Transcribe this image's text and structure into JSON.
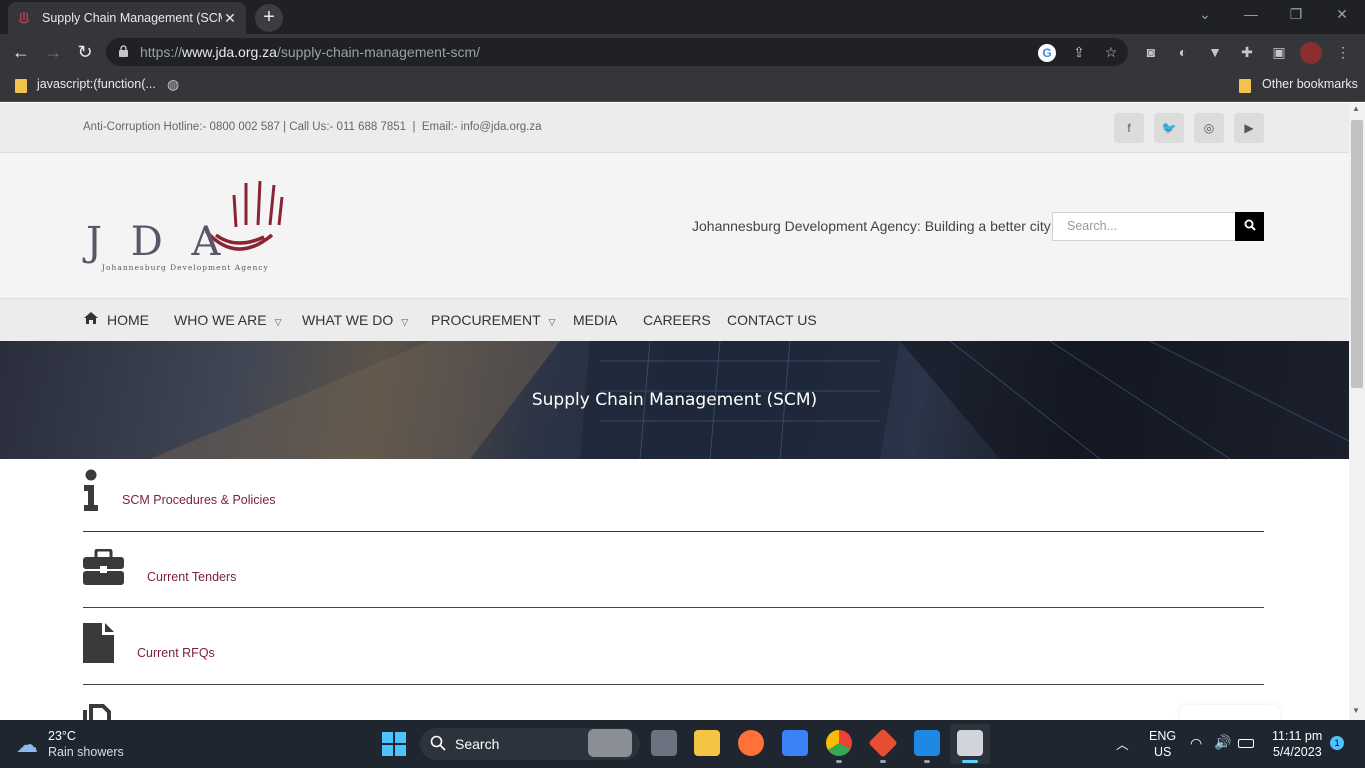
{
  "browser": {
    "tab_title": "Supply Chain Management (SCM)",
    "tab_close": "✕",
    "new_tab": "+",
    "url_scheme": "https://",
    "url_domain": "www.jda.org.za",
    "url_path": "/supply-chain-management-scm/",
    "bookmarks": [
      {
        "label": "javascript:(function(..."
      },
      {
        "label": "Other bookmarks"
      }
    ]
  },
  "site": {
    "contact_bar": "Anti-Corruption Hotline:- 0800 002 587 | Call Us:- 011 688 7851  |  Email:- info@jda.org.za",
    "social": [
      {
        "name": "facebook",
        "glyph": "f"
      },
      {
        "name": "twitter",
        "glyph": "🐦"
      },
      {
        "name": "instagram",
        "glyph": "◎"
      },
      {
        "name": "youtube",
        "glyph": "▶"
      }
    ],
    "logo_letters": "J D A",
    "logo_sub": "Johannesburg Development Agency",
    "tagline": "Johannesburg Development Agency: Building a better city",
    "search_placeholder": "Search...",
    "nav": [
      {
        "label": "HOME"
      },
      {
        "label": "WHO WE ARE"
      },
      {
        "label": "WHAT WE DO"
      },
      {
        "label": "PROCUREMENT"
      },
      {
        "label": "MEDIA"
      },
      {
        "label": "CAREERS"
      },
      {
        "label": "CONTACT US"
      }
    ],
    "hero_title": "Supply Chain Management (SCM)",
    "scm_items": [
      {
        "label": "SCM Procedures & Policies",
        "icon": "info-icon"
      },
      {
        "label": "Current Tenders",
        "icon": "briefcase-icon"
      },
      {
        "label": "Current RFQs",
        "icon": "file-icon"
      },
      {
        "label": "",
        "icon": "copy-icon"
      }
    ],
    "colors": {
      "accent": "#7a1f3d",
      "topbar": "#ececec"
    }
  },
  "taskbar": {
    "weather_temp": "23°C",
    "weather_desc": "Rain showers",
    "search_label": "Search",
    "lang": "ENG",
    "region": "US",
    "time": "11:11 pm",
    "date": "5/4/2023",
    "notifications": "1"
  }
}
